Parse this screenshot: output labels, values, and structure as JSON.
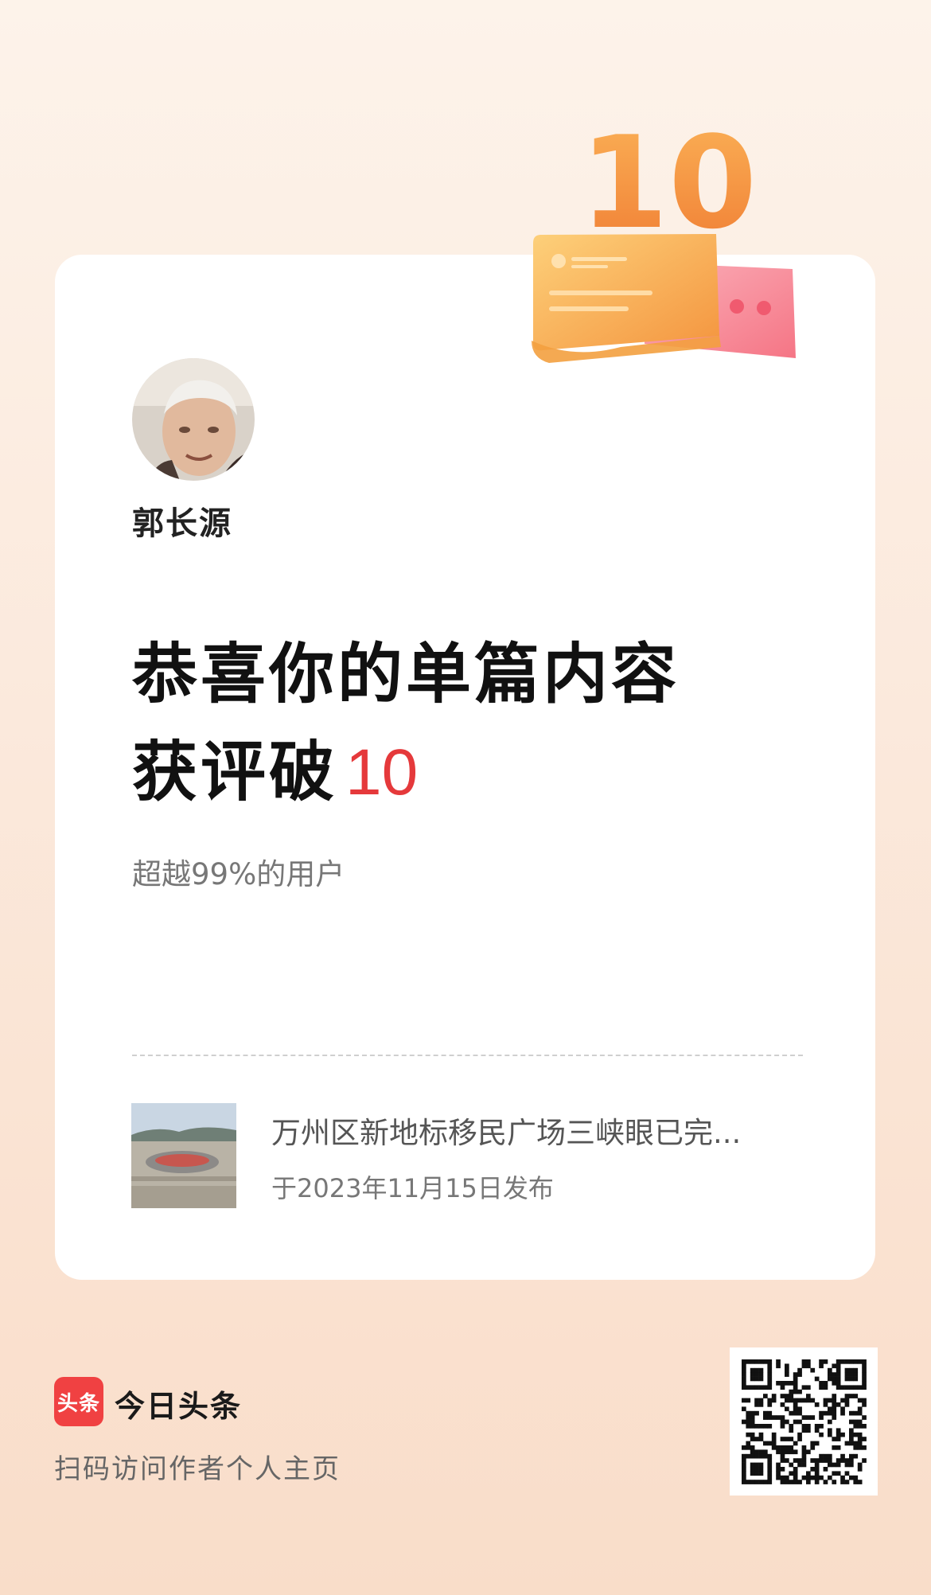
{
  "author": {
    "name": "郭长源"
  },
  "badge": {
    "count_label": "10"
  },
  "headline": {
    "line1": "恭喜你的单篇内容",
    "line2_prefix": "获评破",
    "line2_number": "10"
  },
  "subtitle": "超越99%的用户",
  "article": {
    "title": "万州区新地标移民广场三峡眼已完...",
    "published": "于2023年11月15日发布"
  },
  "footer": {
    "logo_text": "头条",
    "app_name": "今日头条",
    "scan_hint": "扫码访问作者个人主页"
  },
  "colors": {
    "accent": "#e5393b",
    "logo_red": "#f04142",
    "badge_orange": "#f59a3e",
    "badge_pink": "#f7869a"
  }
}
